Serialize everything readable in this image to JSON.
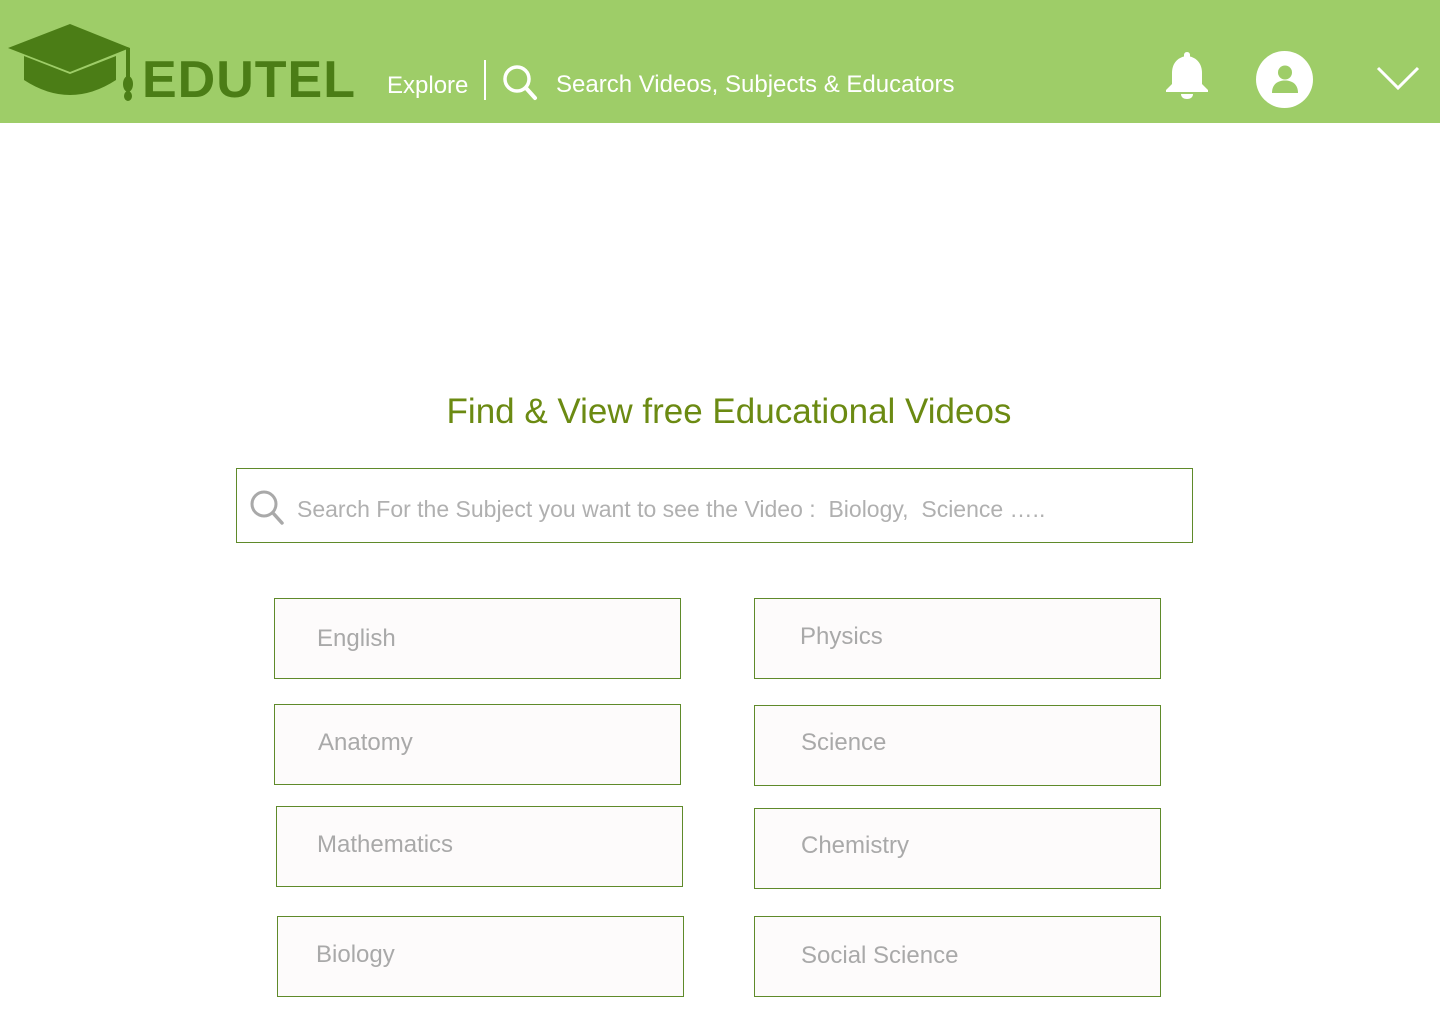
{
  "header": {
    "logo_text": "EDUTEL",
    "explore_label": "Explore",
    "search_placeholder": "Search Videos, Subjects & Educators",
    "icons": [
      "graduation-cap-icon",
      "search-icon",
      "bell-icon",
      "user-icon",
      "chevron-down-icon"
    ]
  },
  "main": {
    "headline": "Find & View free Educational Videos",
    "search_placeholder": "Search For the Subject you want to see the Video :  Biology,  Science ….."
  },
  "subjects": [
    {
      "label": "English"
    },
    {
      "label": "Physics"
    },
    {
      "label": "Anatomy"
    },
    {
      "label": "Science"
    },
    {
      "label": "Mathematics"
    },
    {
      "label": "Chemistry"
    },
    {
      "label": "Biology"
    },
    {
      "label": "Social Science"
    }
  ],
  "colors": {
    "header_bg": "#9ecd68",
    "logo": "#4b7d16",
    "headline": "#6b8a12",
    "border": "#5f8a2a",
    "muted_text": "#a9a9a9"
  }
}
